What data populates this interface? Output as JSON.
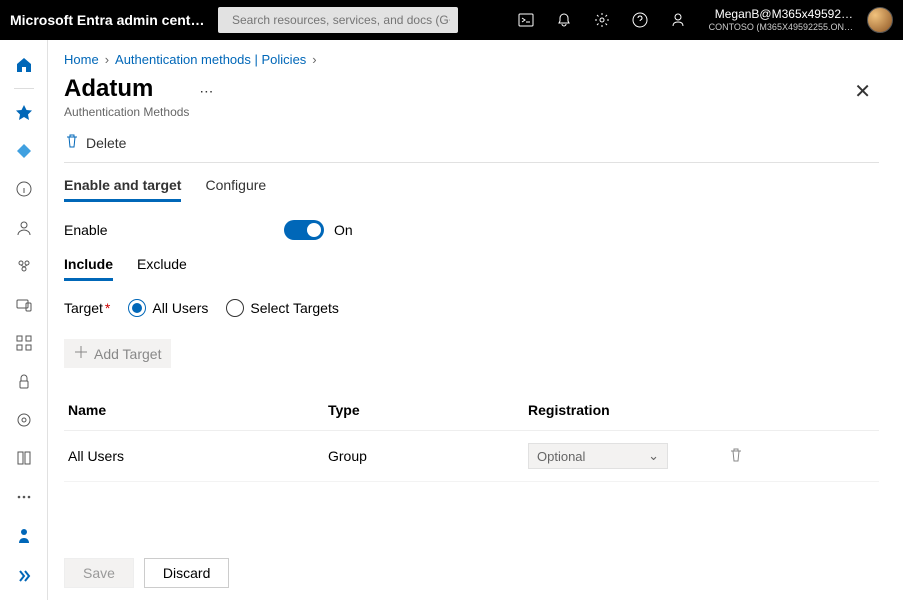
{
  "topbar": {
    "brand": "Microsoft Entra admin cent…",
    "search_placeholder": "Search resources, services, and docs (G+/)",
    "account_email": "MeganB@M365x49592…",
    "account_org": "CONTOSO (M365X49592255.ON…"
  },
  "breadcrumb": {
    "home": "Home",
    "level1": "Authentication methods | Policies"
  },
  "page": {
    "title": "Adatum",
    "subtitle": "Authentication Methods"
  },
  "toolbar": {
    "delete": "Delete"
  },
  "tabs": {
    "enable_target": "Enable and target",
    "configure": "Configure"
  },
  "enable": {
    "label": "Enable",
    "state": "On"
  },
  "subtabs": {
    "include": "Include",
    "exclude": "Exclude"
  },
  "target": {
    "label": "Target",
    "all_users": "All Users",
    "select_targets": "Select Targets"
  },
  "add_target": "Add Target",
  "table": {
    "headers": {
      "name": "Name",
      "type": "Type",
      "registration": "Registration"
    },
    "rows": [
      {
        "name": "All Users",
        "type": "Group",
        "registration": "Optional"
      }
    ]
  },
  "footer": {
    "save": "Save",
    "discard": "Discard"
  }
}
